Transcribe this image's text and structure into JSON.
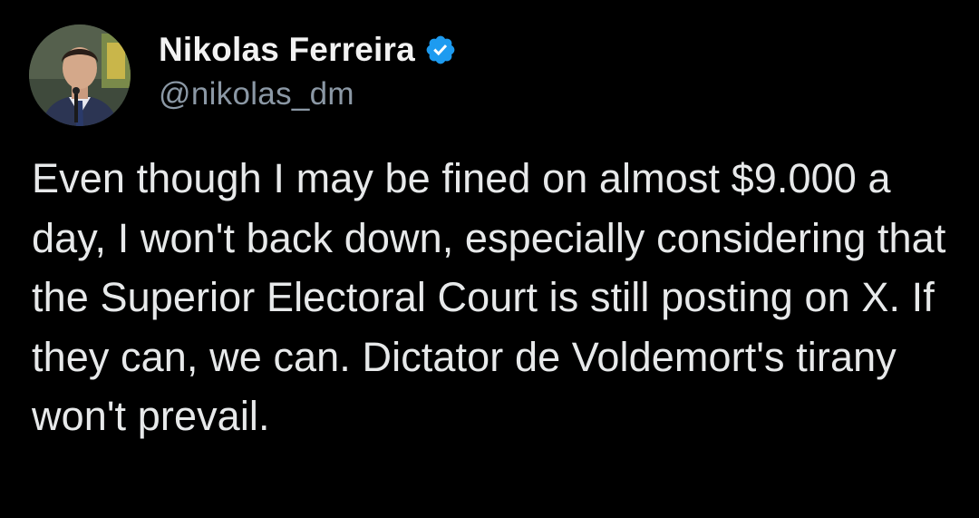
{
  "author": {
    "display_name": "Nikolas Ferreira",
    "handle": "@nikolas_dm",
    "verified": true,
    "avatar_icon": "profile-photo",
    "verified_icon": "verified-badge-icon"
  },
  "tweet": {
    "text": "Even though I may be fined on almost $9.000 a day, I won't back down, especially considering that the Superior Electoral Court is still posting on X. If they can, we can. Dictator de Voldemort's tirany won't prevail."
  },
  "colors": {
    "background": "#000000",
    "name": "#f2f2f2",
    "handle": "#8b98a5",
    "text": "#e7e9ea",
    "verified": "#1d9bf0"
  }
}
